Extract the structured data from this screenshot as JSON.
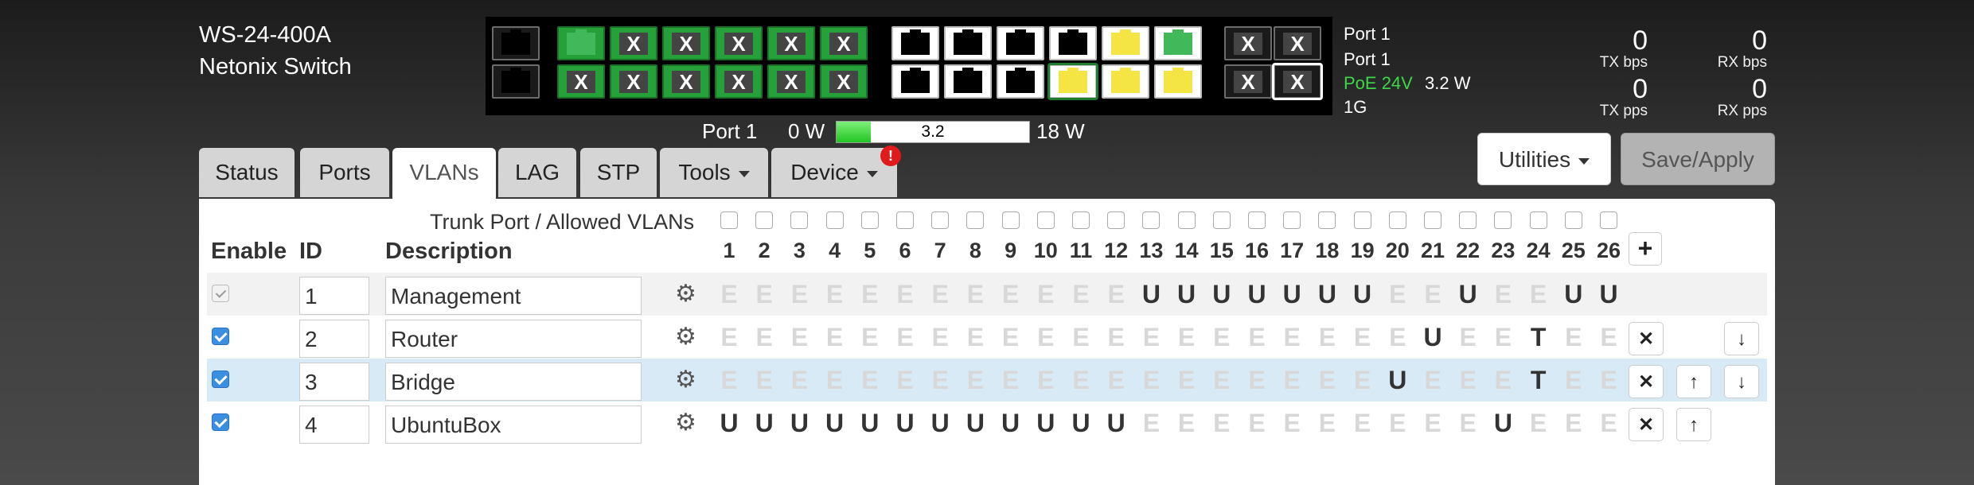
{
  "device": {
    "model": "WS-24-400A",
    "name": "Netonix Switch"
  },
  "port_info": {
    "line1": "Port 1",
    "line2": "Port 1",
    "poe_label": "PoE 24V",
    "poe_power": "3.2 W",
    "speed": "1G"
  },
  "stats": {
    "tx_bps": "0",
    "tx_bps_label": "TX bps",
    "rx_bps": "0",
    "rx_bps_label": "RX bps",
    "tx_pps": "0",
    "tx_pps_label": "TX pps",
    "rx_pps": "0",
    "rx_pps_label": "RX pps"
  },
  "power": {
    "port_label": "Port 1",
    "min_label": "0 W",
    "bar_value": "3.2",
    "bar_fraction": 0.178,
    "max_label": "18 W"
  },
  "tabs": [
    {
      "label": "Status"
    },
    {
      "label": "Ports"
    },
    {
      "label": "VLANs"
    },
    {
      "label": "LAG"
    },
    {
      "label": "STP"
    },
    {
      "label": "Tools"
    },
    {
      "label": "Device"
    }
  ],
  "device_badge": "!",
  "buttons": {
    "utilities": "Utilities",
    "save": "Save/Apply",
    "add": "+"
  },
  "table": {
    "trunk_label": "Trunk Port / Allowed VLANs",
    "headers": {
      "enable": "Enable",
      "id": "ID",
      "description": "Description"
    },
    "port_numbers": [
      "1",
      "2",
      "3",
      "4",
      "5",
      "6",
      "7",
      "8",
      "9",
      "10",
      "11",
      "12",
      "13",
      "14",
      "15",
      "16",
      "17",
      "18",
      "19",
      "20",
      "21",
      "22",
      "23",
      "24",
      "25",
      "26"
    ],
    "rows": [
      {
        "enabled": true,
        "locked": true,
        "id": "1",
        "description": "Management",
        "ports": "EEEEEEEEEEEEUUUUUUUEEUEEUU"
      },
      {
        "enabled": true,
        "locked": false,
        "id": "2",
        "description": "Router",
        "ports": "EEEEEEEEEEEEEEEEEEEEUEETEE"
      },
      {
        "enabled": true,
        "locked": false,
        "id": "3",
        "description": "Bridge",
        "ports": "EEEEEEEEEEEEEEEEEEEUEEETEE"
      },
      {
        "enabled": true,
        "locked": false,
        "id": "4",
        "description": "UbuntuBox",
        "ports": "UUUUUUUUUUUUEEEEEEEEEEUEEE"
      }
    ]
  },
  "icons": {
    "gear": "gear-icon",
    "delete": "close-icon",
    "up": "arrow-up-icon",
    "down": "arrow-down-icon"
  }
}
